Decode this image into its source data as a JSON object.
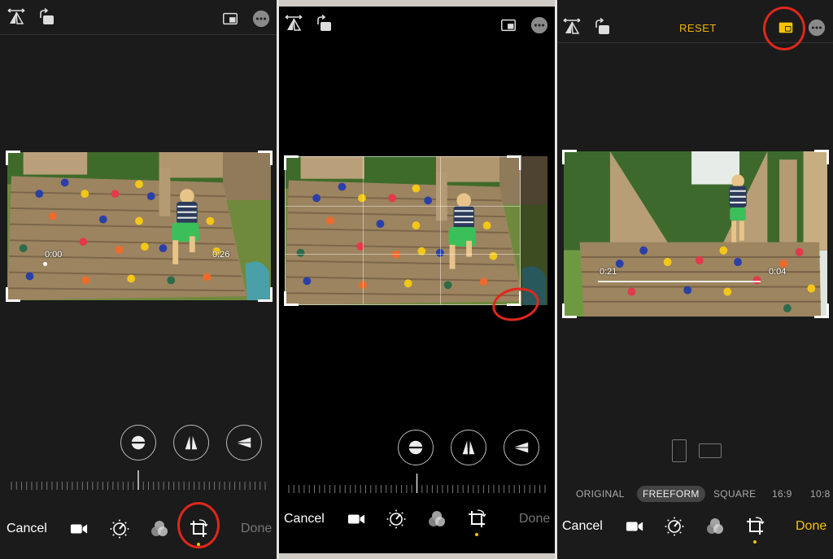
{
  "panels": [
    {
      "id": "panel-1",
      "cancel_label": "Cancel",
      "done_label": "Done",
      "video_start": "0:00",
      "video_end": "0:26",
      "active_tool": "crop",
      "done_color": "#777777"
    },
    {
      "id": "panel-2",
      "cancel_label": "Cancel",
      "done_label": "Done",
      "active_tool": "crop",
      "done_color": "#777777"
    },
    {
      "id": "panel-3",
      "reset_label": "RESET",
      "cancel_label": "Cancel",
      "done_label": "Done",
      "video_start": "0:21",
      "video_end": "0:04",
      "aspect_ratios": [
        "ORIGINAL",
        "FREEFORM",
        "SQUARE",
        "16:9",
        "10:8"
      ],
      "selected_ratio": "FREEFORM",
      "active_tool": "crop",
      "done_color": "#f5c400"
    }
  ],
  "icons": {
    "flip": "flip-horizontal-icon",
    "rotate": "rotate-icon",
    "aspect": "aspect-ratio-icon",
    "more": "more-options-icon",
    "straighten": "straighten-icon",
    "vertical": "vertical-perspective-icon",
    "horizontal": "horizontal-perspective-icon",
    "video": "video-icon",
    "adjust": "adjust-dial-icon",
    "filters": "filters-icon",
    "crop": "crop-icon"
  },
  "colors": {
    "accent_yellow": "#f5c400",
    "annotation_red": "#e0271c",
    "panel_bg": "#1b1b1b"
  }
}
